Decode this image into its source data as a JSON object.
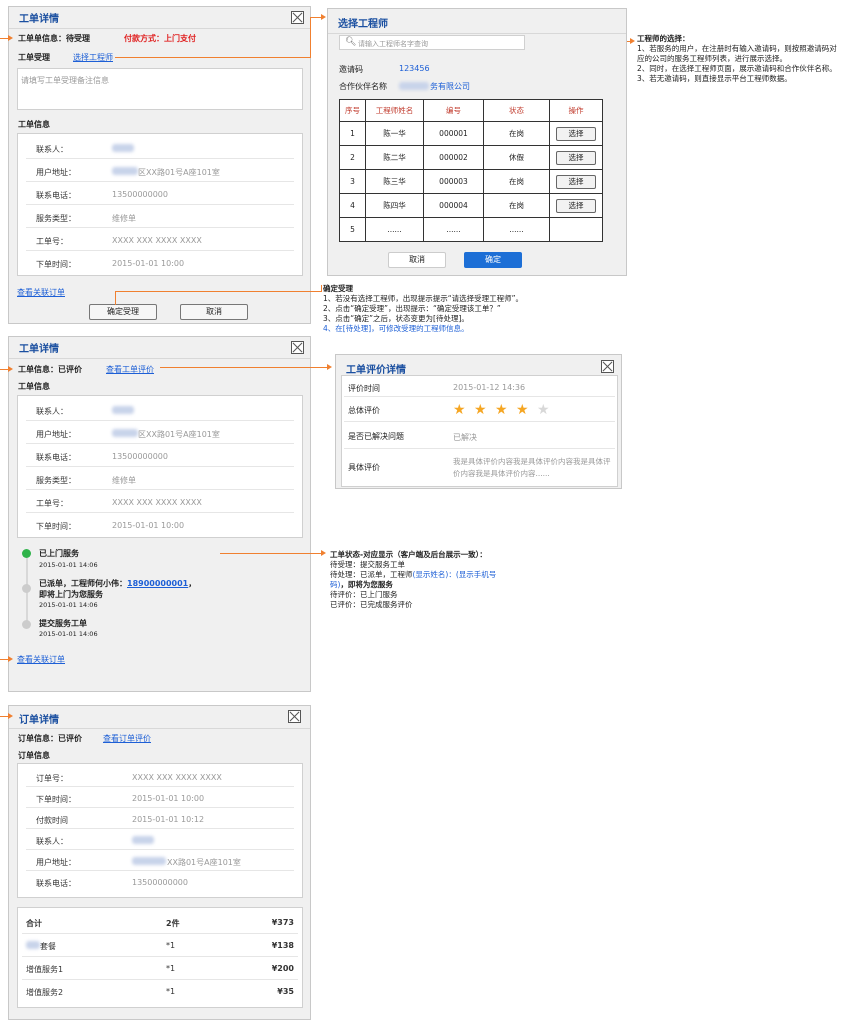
{
  "panel1": {
    "title": "工单详情",
    "status_text": "工单单信息：待受理",
    "payment": "付款方式：上门支付",
    "accept_label": "工单受理",
    "choose_engineer": "选择工程师",
    "remark_placeholder": "请填写工单受理备注信息",
    "info_title": "工单信息",
    "rows": [
      {
        "k": "联系人：",
        "v": ""
      },
      {
        "k": "用户地址：",
        "v": "区XX路01号A座101室"
      },
      {
        "k": "联系电话：",
        "v": "13500000000"
      },
      {
        "k": "服务类型：",
        "v": "维修单"
      },
      {
        "k": "工单号：",
        "v": "XXXX XXX XXXX XXXX"
      },
      {
        "k": "下单时间：",
        "v": "2015-01-01 10:00"
      }
    ],
    "related_order": "查看关联订单",
    "confirm": "确定受理",
    "cancel": "取消"
  },
  "select_engineer": {
    "title": "选择工程师",
    "search_placeholder": "请输入工程师名字查询",
    "invite_label": "邀请码",
    "invite_code": "123456",
    "partner_label": "合作伙伴名称",
    "partner_value": "务有限公司",
    "columns": [
      "序号",
      "工程师姓名",
      "编号",
      "状态",
      "操作"
    ],
    "rows": [
      {
        "no": "1",
        "name": "陈一华",
        "id": "000001",
        "status": "在岗",
        "op": "选择"
      },
      {
        "no": "2",
        "name": "陈二华",
        "id": "000002",
        "status": "休假",
        "op": "选择"
      },
      {
        "no": "3",
        "name": "陈三华",
        "id": "000003",
        "status": "在岗",
        "op": "选择"
      },
      {
        "no": "4",
        "name": "陈四华",
        "id": "000004",
        "status": "在岗",
        "op": "选择"
      },
      {
        "no": "5",
        "name": "......",
        "id": "......",
        "status": "......",
        "op": ""
      }
    ],
    "cancel": "取消",
    "ok": "确定"
  },
  "note_engineer": {
    "title": "工程师的选择：",
    "lines": [
      "1、若服务的用户，在注册时有输入邀请码，则按照邀请码对",
      "应的公司的服务工程师列表，进行展示选择。",
      "2、同时，在选择工程师页面，展示邀请码和合作伙伴名称。",
      "3、若无邀请码，则直接显示平台工程师数据。"
    ]
  },
  "note_confirm": {
    "title": "确定受理",
    "lines": [
      "1、若没有选择工程师，出现提示提示“请选择受理工程师”。",
      "2、点击“确定受理”，出现提示：“确定受理该工单？”",
      "3、点击“确定”之后，状态变更为[待处理]。"
    ],
    "blue_line": "4、在[待处理]，可修改受理的工程师信息。"
  },
  "panel2": {
    "title": "工单详情",
    "status_text": "工单信息：已评价",
    "view_eval": "查看工单评价",
    "info_title": "工单信息",
    "rows": [
      {
        "k": "联系人：",
        "v": ""
      },
      {
        "k": "用户地址：",
        "v": "区XX路01号A座101室"
      },
      {
        "k": "联系电话：",
        "v": "13500000000"
      },
      {
        "k": "服务类型：",
        "v": "维修单"
      },
      {
        "k": "工单号：",
        "v": "XXXX XXX XXXX XXXX"
      },
      {
        "k": "下单时间：",
        "v": "2015-01-01 10:00"
      }
    ],
    "timeline": [
      {
        "title": "已上门服务",
        "time": "2015-01-01 14:06"
      },
      {
        "title_a": "已派单，工程师何小伟：",
        "phone": "18900000001",
        "title_b": "，",
        "title_c": "即将上门为您服务",
        "time": "2015-01-01 14:06"
      },
      {
        "title": "提交服务工单",
        "time": "2015-01-01 14:06"
      }
    ],
    "related_order": "查看关联订单"
  },
  "eval_detail": {
    "title": "工单评价详情",
    "time_label": "评价时间",
    "time_value": "2015-01-12 14:36",
    "overall_label": "总体评价",
    "rating": 4,
    "rating_max": 5,
    "solved_label": "是否已解决问题",
    "solved_value": "已解决",
    "detail_label": "具体评价",
    "detail_value_1": "我是具体评价内容我是具体评价内容我是具体评",
    "detail_value_2": "价内容我是具体评价内容......"
  },
  "note_status": {
    "title": "工单状态-对应显示（客户端及后台展示一致）：",
    "l1": "待受理：提交服务工单",
    "l2a": "待处理：已派单，工程师",
    "l2b": "(显示姓名)：(显示手机号",
    "l3a": "码)",
    "l3b": "，即将为您服务",
    "l4": "待评价：已上门服务",
    "l5": "已评价：已完成服务评价"
  },
  "panel3": {
    "title": "订单详情",
    "status_text": "订单信息：已评价",
    "view_eval": "查看订单评价",
    "info_title": "订单信息",
    "rows": [
      {
        "k": "订单号：",
        "v": "XXXX XXX XXXX XXXX"
      },
      {
        "k": "下单时间：",
        "v": "2015-01-01 10:00"
      },
      {
        "k": "付款时间",
        "v": "2015-01-01 10:12"
      },
      {
        "k": "联系人：",
        "v": ""
      },
      {
        "k": "用户地址：",
        "v": "XX路01号A座101室"
      },
      {
        "k": "联系电话：",
        "v": "13500000000"
      }
    ],
    "total_label": "合计",
    "total_count": "2件",
    "total_price": "¥373",
    "items": [
      {
        "name": "套餐",
        "qty": "*1",
        "price": "¥138"
      },
      {
        "name": "增值服务1",
        "qty": "*1",
        "price": "¥200"
      },
      {
        "name": "增值服务2",
        "qty": "*1",
        "price": "¥35"
      }
    ]
  },
  "colors": {
    "accent": "#f08030",
    "title_blue": "#1a4fa0",
    "link_blue": "#1d5fd6",
    "star": "#f5a623",
    "active_dot": "#2fb34a"
  }
}
